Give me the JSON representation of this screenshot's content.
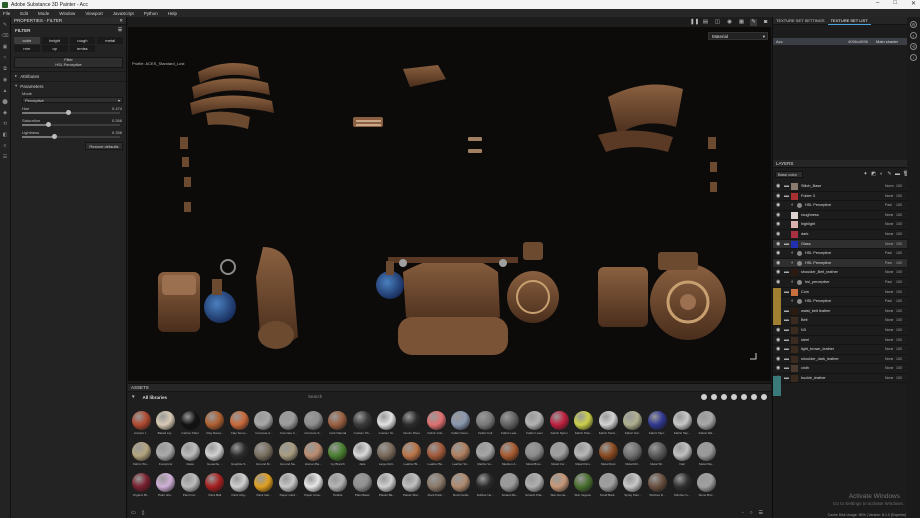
{
  "window": {
    "title": "Adobe Substance 3D Painter - Acc"
  },
  "menu": [
    "File",
    "Edit",
    "Mode",
    "Window",
    "Viewport",
    "JavaScript",
    "Python",
    "Help"
  ],
  "properties": {
    "panel_title": "PROPERTIES - FILTER",
    "filter_label": "FILTER",
    "categories": [
      "color",
      "height",
      "rough",
      "metal",
      "nrm",
      "op",
      "emiss"
    ],
    "filter_slot_title": "Filter",
    "filter_slot_name": "HSL Perceptive",
    "attributes_label": "Attributes",
    "parameters_label": "Parameters",
    "mode_label": "Mode",
    "mode_value": "Perceptive",
    "hue": {
      "label": "Hue",
      "value": "0.474",
      "fraction": 0.474
    },
    "saturation": {
      "label": "Saturation",
      "value": "0.266",
      "fraction": 0.266
    },
    "lightness": {
      "label": "Lightness",
      "value": "0.336",
      "fraction": 0.336
    },
    "restore_label": "Restore defaults"
  },
  "viewport": {
    "material_dropdown": "Material",
    "profile_text": "Profile: ACES_Standard_Lost"
  },
  "assets": {
    "panel_title": "ASSETS",
    "all_label": "All libraries",
    "search_placeholder": "Search",
    "rows": [
      [
        {
          "label": "Ancient I...",
          "color": "#b04a30"
        },
        {
          "label": "Baked Lig...",
          "color": "#d9cbb4"
        },
        {
          "label": "Carbon Fiber",
          "color": "#121212"
        },
        {
          "label": "Clay Dama...",
          "color": "#b06030"
        },
        {
          "label": "Clay Smoo...",
          "color": "#c9693a"
        },
        {
          "label": "Concrete A...",
          "color": "#a8a8a8"
        },
        {
          "label": "Concrete C...",
          "color": "#9c9c9c"
        },
        {
          "label": "Concrete S...",
          "color": "#8e8e8e"
        },
        {
          "label": "Cork Natural",
          "color": "#9a6040"
        },
        {
          "label": "Custom Sh...",
          "color": "#3a3a3a"
        },
        {
          "label": "Custom St...",
          "color": "#e2e2e2"
        },
        {
          "label": "Denim Rivet",
          "color": "#2c2c2c"
        },
        {
          "label": "Fabric Cott...",
          "color": "#e07070"
        },
        {
          "label": "Fabric Dens...",
          "color": "#8a98b0"
        },
        {
          "label": "Fabric Felt",
          "color": "#7a7a7a"
        },
        {
          "label": "Fabric Leat...",
          "color": "#646464"
        },
        {
          "label": "Fabric Linen",
          "color": "#b3b3b3"
        },
        {
          "label": "Fabric Nylon",
          "color": "#c02040"
        },
        {
          "label": "Fabric Polo...",
          "color": "#cbd04a"
        },
        {
          "label": "Fabric Swim...",
          "color": "#d4d4d4"
        },
        {
          "label": "Fabric Sof...",
          "color": "#b0b090"
        },
        {
          "label": "Fabric Tapi...",
          "color": "#303890"
        },
        {
          "label": "Fabric Tap...",
          "color": "#c8c8c8"
        },
        {
          "label": "Fabric Wa...",
          "color": "#a8a8a8"
        }
      ],
      [
        {
          "label": "Fabric Wo...",
          "color": "#b5a57e"
        },
        {
          "label": "Footprints",
          "color": "#ababab"
        },
        {
          "label": "Glass",
          "color": "#bcbcbc"
        },
        {
          "label": "Gouache ...",
          "color": "#d2d2d2"
        },
        {
          "label": "Graphite S...",
          "color": "#2b2b2b"
        },
        {
          "label": "Ground M...",
          "color": "#7a7060"
        },
        {
          "label": "Ground Sa...",
          "color": "#a89c80"
        },
        {
          "label": "Human Ba...",
          "color": "#ba8c70"
        },
        {
          "label": "Ivy Branch",
          "color": "#4a8030"
        },
        {
          "label": "Jade",
          "color": "#d9d9d9"
        },
        {
          "label": "Large Roll...",
          "color": "#7a6a5a"
        },
        {
          "label": "Leather Bl...",
          "color": "#bb7448"
        },
        {
          "label": "Leather Bu...",
          "color": "#a35a3a"
        },
        {
          "label": "Leather Sti...",
          "color": "#b08060"
        },
        {
          "label": "Marble Ve...",
          "color": "#a6a6a6"
        },
        {
          "label": "Medium A...",
          "color": "#a85a30"
        },
        {
          "label": "Metal Brus...",
          "color": "#8c8c8c"
        },
        {
          "label": "Metal Cor...",
          "color": "#a0a0a0"
        },
        {
          "label": "Metal Pain...",
          "color": "#b8b8b8"
        },
        {
          "label": "Metal Rust",
          "color": "#8a4a20"
        },
        {
          "label": "Metal Dirt...",
          "color": "#707070"
        },
        {
          "label": "Metal Sh...",
          "color": "#5a5a5a"
        },
        {
          "label": "Nail",
          "color": "#c0c0c0"
        },
        {
          "label": "Metal Wa...",
          "color": "#9a9a9a"
        }
      ],
      [
        {
          "label": "Organic Bl...",
          "color": "#7a2030"
        },
        {
          "label": "Paint Glo...",
          "color": "#d0b0d8"
        },
        {
          "label": "Paint Cur...",
          "color": "#bcbcbc"
        },
        {
          "label": "Paint Ball",
          "color": "#a82020"
        },
        {
          "label": "Paint Orig...",
          "color": "#d0d0d0"
        },
        {
          "label": "Paint Gal...",
          "color": "#e0a020"
        },
        {
          "label": "Paper Card...",
          "color": "#c8c8c8"
        },
        {
          "label": "Paper Crea...",
          "color": "#e8e8e8"
        },
        {
          "label": "Pebble",
          "color": "#b5b5b5"
        },
        {
          "label": "Plain Basic",
          "color": "#909090"
        },
        {
          "label": "Plastic Ba...",
          "color": "#d0d0d0"
        },
        {
          "label": "Plastic Mat...",
          "color": "#c0c0c0"
        },
        {
          "label": "Rock Patin...",
          "color": "#8a7a6a"
        },
        {
          "label": "Rock Fields",
          "color": "#b08c70"
        },
        {
          "label": "Rubber Ne...",
          "color": "#2a2a2a"
        },
        {
          "label": "Scaled Me...",
          "color": "#9a9a9a"
        },
        {
          "label": "Scratch Plat...",
          "color": "#b0b0b0"
        },
        {
          "label": "Skin Huma...",
          "color": "#c89878"
        },
        {
          "label": "Skin Vegeta...",
          "color": "#4a7030"
        },
        {
          "label": "Small Bark...",
          "color": "#a0a0a0"
        },
        {
          "label": "Spray Pain...",
          "color": "#c8c8c8"
        },
        {
          "label": "Stitches D...",
          "color": "#6a5040"
        },
        {
          "label": "Stitches G...",
          "color": "#303030"
        },
        {
          "label": "Stone Bric...",
          "color": "#a0a0a0"
        }
      ]
    ]
  },
  "texture_set": {
    "tab_settings": "TEXTURE SET SETTINGS",
    "tab_list": "TEXTURE SET LIST",
    "row_name": "Acc",
    "row_res": "4096x4096",
    "row_shader": "Main shader"
  },
  "layers": {
    "panel_title": "LAYERS",
    "channel": "Base color",
    "items": [
      {
        "name": "Stitch_Base",
        "blend": "Norm",
        "opacity": "100",
        "thumb": "#8a7a70",
        "sub": false,
        "group": true
      },
      {
        "name": "Folder 3",
        "blend": "None",
        "opacity": "100",
        "thumb": "#a83030",
        "sub": false,
        "group": true
      },
      {
        "name": "HSL Perceptive",
        "blend": "Pasl",
        "opacity": "100",
        "thumb": "#888888",
        "sub": true,
        "group": false
      },
      {
        "name": "roughness",
        "blend": "None",
        "opacity": "100",
        "thumb": "#ddd0d0",
        "sub": false,
        "group": false
      },
      {
        "name": "highlight",
        "blend": "None",
        "opacity": "100",
        "thumb": "#d8b0b0",
        "sub": false,
        "group": false
      },
      {
        "name": "dark",
        "blend": "None",
        "opacity": "100",
        "thumb": "#a83040",
        "sub": false,
        "group": false
      },
      {
        "name": "Glass",
        "blend": "None",
        "opacity": "100",
        "thumb": "#2030b0",
        "sub": false,
        "group": true
      },
      {
        "name": "HSL Perceptive",
        "blend": "Pasl",
        "opacity": "100",
        "thumb": "#888888",
        "sub": true,
        "group": false
      },
      {
        "name": "HSL Perceptive",
        "blend": "Pasl",
        "opacity": "100",
        "thumb": "#888888",
        "sub": true,
        "group": false
      },
      {
        "name": "shoulder_Belt_leather",
        "blend": "None",
        "opacity": "100",
        "thumb": "#2a1a10",
        "sub": false,
        "group": true
      },
      {
        "name": "hsl_perceptive",
        "blend": "Pasl",
        "opacity": "100",
        "thumb": "#888888",
        "sub": true,
        "group": false
      },
      {
        "name": "Coin",
        "blend": "None",
        "opacity": "100",
        "thumb": "#c87040",
        "sub": false,
        "group": true
      },
      {
        "name": "HSL Perceptive",
        "blend": "Pasl",
        "opacity": "100",
        "thumb": "#888888",
        "sub": true,
        "group": false
      },
      {
        "name": "waist_belt leather",
        "blend": "None",
        "opacity": "100",
        "thumb": "#2a1a10",
        "sub": false,
        "group": true
      },
      {
        "name": "Belt",
        "blend": "None",
        "opacity": "100",
        "thumb": "#3a2a20",
        "sub": false,
        "group": true
      },
      {
        "name": "N3",
        "blend": "None",
        "opacity": "100",
        "thumb": "#3a2a20",
        "sub": false,
        "group": true
      },
      {
        "name": "steel",
        "blend": "None",
        "opacity": "100",
        "thumb": "#3a2a20",
        "sub": false,
        "group": true
      },
      {
        "name": "light_brown_leather",
        "blend": "None",
        "opacity": "100",
        "thumb": "#3a2a20",
        "sub": false,
        "group": true
      },
      {
        "name": "shoulder_dark_leather",
        "blend": "None",
        "opacity": "100",
        "thumb": "#3a2a20",
        "sub": false,
        "group": true
      },
      {
        "name": "cloth",
        "blend": "None",
        "opacity": "100",
        "thumb": "#4a3a30",
        "sub": false,
        "group": true
      },
      {
        "name": "buckle_leather",
        "blend": "None",
        "opacity": "100",
        "thumb": "#3a2a20",
        "sub": false,
        "group": true
      }
    ]
  },
  "watermark": {
    "line1": "Activate Windows",
    "line2": "Go to Settings to activate Windows."
  },
  "status": "Cache Disk Usage: 96% | Version: 8.1.0 (Experim)"
}
